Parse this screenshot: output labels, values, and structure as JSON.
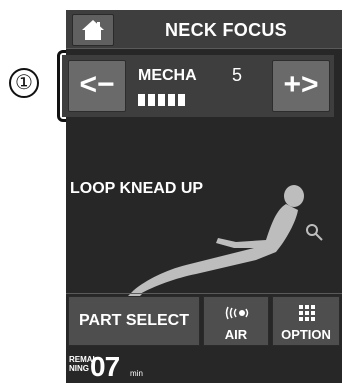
{
  "header": {
    "title": "NECK FOCUS"
  },
  "mecha": {
    "minus_label": "<−",
    "label": "MECHA",
    "value": "5",
    "plus_label": "+>",
    "level_bars": 5
  },
  "callout": {
    "number": "①"
  },
  "course": {
    "name": "LOOP KNEAD UP"
  },
  "bottom": {
    "part_select": "PART SELECT",
    "air": "AIR",
    "option": "OPTION"
  },
  "timer": {
    "remaining_line1": "REMAI",
    "remaining_line2": "NING",
    "value": "07",
    "unit": "min"
  },
  "icons": {
    "home": "home-icon",
    "air": "air-icon",
    "option": "option-grid-icon",
    "figure": "reclined-person-icon"
  }
}
